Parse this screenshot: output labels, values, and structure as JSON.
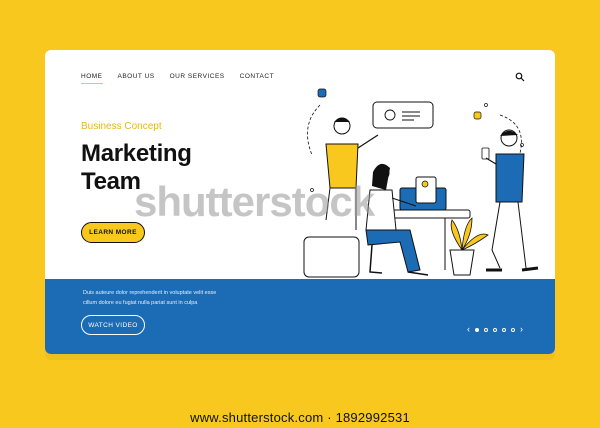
{
  "nav": {
    "items": [
      {
        "label": "HOME",
        "active": true
      },
      {
        "label": "ABOUT US",
        "active": false
      },
      {
        "label": "OUR SERVICES",
        "active": false
      },
      {
        "label": "CONTACT",
        "active": false
      }
    ],
    "search_icon": "search-icon"
  },
  "hero": {
    "eyebrow": "Business Concept",
    "title": "Marketing\nTeam",
    "cta_label": "LEARN MORE"
  },
  "bottom": {
    "description_line1": "Duis auteure dolor reprehenderit in voluptate velit esse",
    "description_line2": "cillum dolore eu fugiat nulla pariat sunt in culpa",
    "watch_label": "WATCH VIDEO",
    "pager": {
      "prev_icon": "chevron-left-icon",
      "next_icon": "chevron-right-icon",
      "dots": 5,
      "active_dot": 1
    }
  },
  "colors": {
    "background": "#f8c81e",
    "accent_blue": "#1c6bb5",
    "accent_yellow": "#f8c81e",
    "text_dark": "#111111"
  },
  "watermark": "shutterstock",
  "footer_url": "www.shutterstock.com · 1892992531"
}
